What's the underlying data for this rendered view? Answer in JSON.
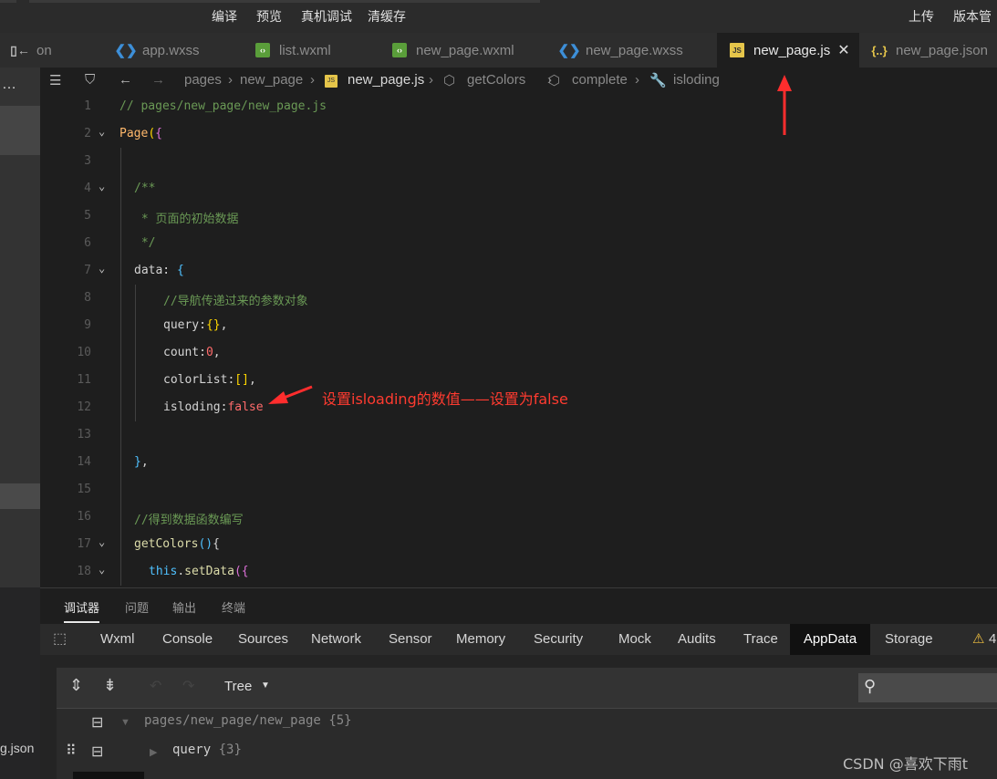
{
  "topbar": {
    "menu": [
      "编译",
      "预览",
      "真机调试",
      "清缓存"
    ],
    "right_menu": [
      "上传",
      "版本管"
    ]
  },
  "tabs": [
    {
      "label": "on",
      "icon": "sidebar-toggle-icon",
      "active": false
    },
    {
      "label": "app.wxss",
      "icon": "css-file-icon",
      "active": false
    },
    {
      "label": "list.wxml",
      "icon": "wxml-file-icon",
      "active": false
    },
    {
      "label": "new_page.wxml",
      "icon": "wxml-file-icon",
      "active": false
    },
    {
      "label": "new_page.wxss",
      "icon": "css-file-icon",
      "active": false
    },
    {
      "label": "new_page.js",
      "icon": "js-file-icon",
      "active": true
    },
    {
      "label": "new_page.json",
      "icon": "json-file-icon",
      "active": false
    }
  ],
  "breadcrumb": [
    "pages",
    "new_page",
    "new_page.js",
    "getColors",
    "complete",
    "isloding"
  ],
  "code_lines": [
    {
      "n": "1",
      "text": "// pages/new_page/new_page.js"
    },
    {
      "n": "2",
      "text": "Page({"
    },
    {
      "n": "3",
      "text": ""
    },
    {
      "n": "4",
      "text": "/**"
    },
    {
      "n": "5",
      "text": " * 页面的初始数据"
    },
    {
      "n": "6",
      "text": " */"
    },
    {
      "n": "7",
      "text": "data: {"
    },
    {
      "n": "8",
      "text": "//导航传递过来的参数对象"
    },
    {
      "n": "9",
      "text": "query:{},"
    },
    {
      "n": "10",
      "text": "count:0,"
    },
    {
      "n": "11",
      "text": "colorList:[],"
    },
    {
      "n": "12",
      "text": "isloding:false"
    },
    {
      "n": "13",
      "text": ""
    },
    {
      "n": "14",
      "text": "},"
    },
    {
      "n": "15",
      "text": ""
    },
    {
      "n": "16",
      "text": "//得到数据函数编写"
    },
    {
      "n": "17",
      "text": "getColors(){"
    },
    {
      "n": "18",
      "text": "this.setData({"
    }
  ],
  "annotation": "设置isloading的数值——设置为false",
  "panel_tabs": [
    "调试器",
    "问题",
    "输出",
    "终端"
  ],
  "devtools_tabs": [
    "Wxml",
    "Console",
    "Sources",
    "Network",
    "Sensor",
    "Memory",
    "Security",
    "Mock",
    "Audits",
    "Trace",
    "AppData",
    "Storage"
  ],
  "devtools_active": "AppData",
  "warning_count": "4",
  "appdata": {
    "view_mode": "Tree",
    "root_path": "pages/new_page/new_page",
    "root_count": "{5}",
    "child_key": "query",
    "child_count": "{3}"
  },
  "sidebar_bottom_label": "g.json",
  "watermark": "CSDN @喜欢下雨t"
}
